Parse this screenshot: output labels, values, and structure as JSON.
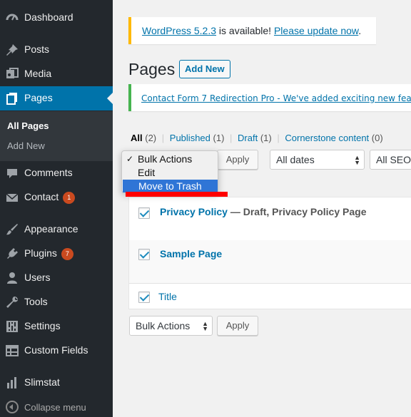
{
  "sidebar": {
    "items": [
      {
        "label": "Dashboard",
        "icon": "dashboard-icon"
      },
      {
        "label": "Posts",
        "icon": "pin-icon"
      },
      {
        "label": "Media",
        "icon": "media-icon"
      },
      {
        "label": "Pages",
        "icon": "pages-icon"
      },
      {
        "label": "Comments",
        "icon": "comment-icon"
      },
      {
        "label": "Contact",
        "icon": "mail-icon",
        "badge": "1"
      },
      {
        "label": "Appearance",
        "icon": "brush-icon"
      },
      {
        "label": "Plugins",
        "icon": "plug-icon",
        "badge": "7"
      },
      {
        "label": "Users",
        "icon": "user-icon"
      },
      {
        "label": "Tools",
        "icon": "wrench-icon"
      },
      {
        "label": "Settings",
        "icon": "sliders-icon"
      },
      {
        "label": "Custom Fields",
        "icon": "table-icon"
      },
      {
        "label": "Slimstat",
        "icon": "chart-icon"
      }
    ],
    "submenu": [
      {
        "label": "All Pages"
      },
      {
        "label": "Add New"
      }
    ],
    "collapse_label": "Collapse menu",
    "accent": "#0073aa"
  },
  "notices": {
    "update_link": "WordPress 5.2.3",
    "update_text": " is available! ",
    "update_action": "Please update now",
    "update_period": ".",
    "plugin_text": "Contact Form 7 Redirection Pro - We've added exciting new fea"
  },
  "page": {
    "title": "Pages",
    "add_new": "Add New"
  },
  "filters": {
    "all": "All",
    "all_count": "(2)",
    "published": "Published",
    "published_count": "(1)",
    "draft": "Draft",
    "draft_count": "(1)",
    "cornerstone": "Cornerstone content",
    "cornerstone_count": "(0)",
    "apply": "Apply",
    "dates": "All dates",
    "seo": "All SEO"
  },
  "bulk_dropdown": {
    "options": [
      "Bulk Actions",
      "Edit",
      "Move to Trash"
    ],
    "selected": "Bulk Actions",
    "highlighted": "Move to Trash"
  },
  "table": {
    "rows": [
      {
        "title": "Privacy Policy",
        "state": " — Draft, Privacy Policy Page"
      },
      {
        "title": "Sample Page",
        "state": ""
      }
    ],
    "footer_column": "Title"
  },
  "bottom": {
    "bulk_actions": "Bulk Actions",
    "apply": "Apply"
  }
}
